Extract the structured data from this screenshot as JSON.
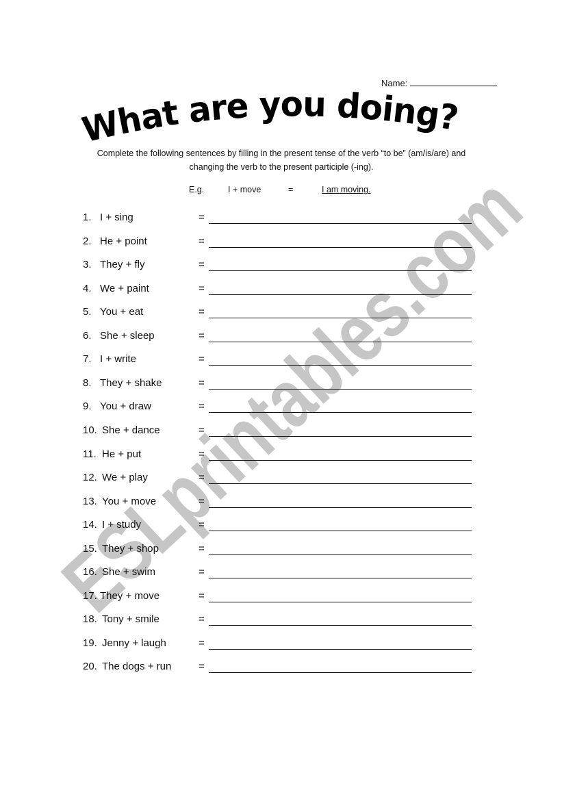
{
  "header": {
    "name_label": "Name:"
  },
  "title": "What are you doing?",
  "instructions": {
    "line1": "Complete the following sentences by filling in the present tense of the verb “to be” (am/is/are) and",
    "line2": "changing the verb to the present participle (-ing)."
  },
  "example": {
    "label": "E.g.",
    "prompt": "I + move",
    "equals": "=",
    "answer": "I am moving."
  },
  "items": [
    {
      "number": "1.",
      "prompt": "I + sing",
      "equals": "="
    },
    {
      "number": "2.",
      "prompt": "He + point",
      "equals": "="
    },
    {
      "number": "3.",
      "prompt": "They + fly",
      "equals": "="
    },
    {
      "number": "4.",
      "prompt": "We + paint",
      "equals": "="
    },
    {
      "number": "5.",
      "prompt": "You + eat",
      "equals": "="
    },
    {
      "number": "6.",
      "prompt": "She + sleep",
      "equals": "="
    },
    {
      "number": "7.",
      "prompt": "I + write",
      "equals": "="
    },
    {
      "number": "8.",
      "prompt": "They + shake",
      "equals": "="
    },
    {
      "number": "9.",
      "prompt": "You + draw",
      "equals": "="
    },
    {
      "number": "10.",
      "prompt": "She + dance",
      "equals": "="
    },
    {
      "number": "11.",
      "prompt": "He + put",
      "equals": "="
    },
    {
      "number": "12.",
      "prompt": "We + play",
      "equals": "="
    },
    {
      "number": "13.",
      "prompt": "You + move",
      "equals": "="
    },
    {
      "number": "14.",
      "prompt": "I + study",
      "equals": "="
    },
    {
      "number": "15.",
      "prompt": "They + shop",
      "equals": "="
    },
    {
      "number": "16.",
      "prompt": "She + swim",
      "equals": "="
    },
    {
      "number": "17.",
      "prompt": "They + move",
      "equals": "="
    },
    {
      "number": "18.",
      "prompt": "Tony + smile",
      "equals": "="
    },
    {
      "number": "19.",
      "prompt": "Jenny + laugh",
      "equals": "="
    },
    {
      "number": "20.",
      "prompt": "The dogs + run",
      "equals": "="
    }
  ],
  "watermark": {
    "text": "ESLprintables.com",
    "color": "#c6c6c6"
  }
}
